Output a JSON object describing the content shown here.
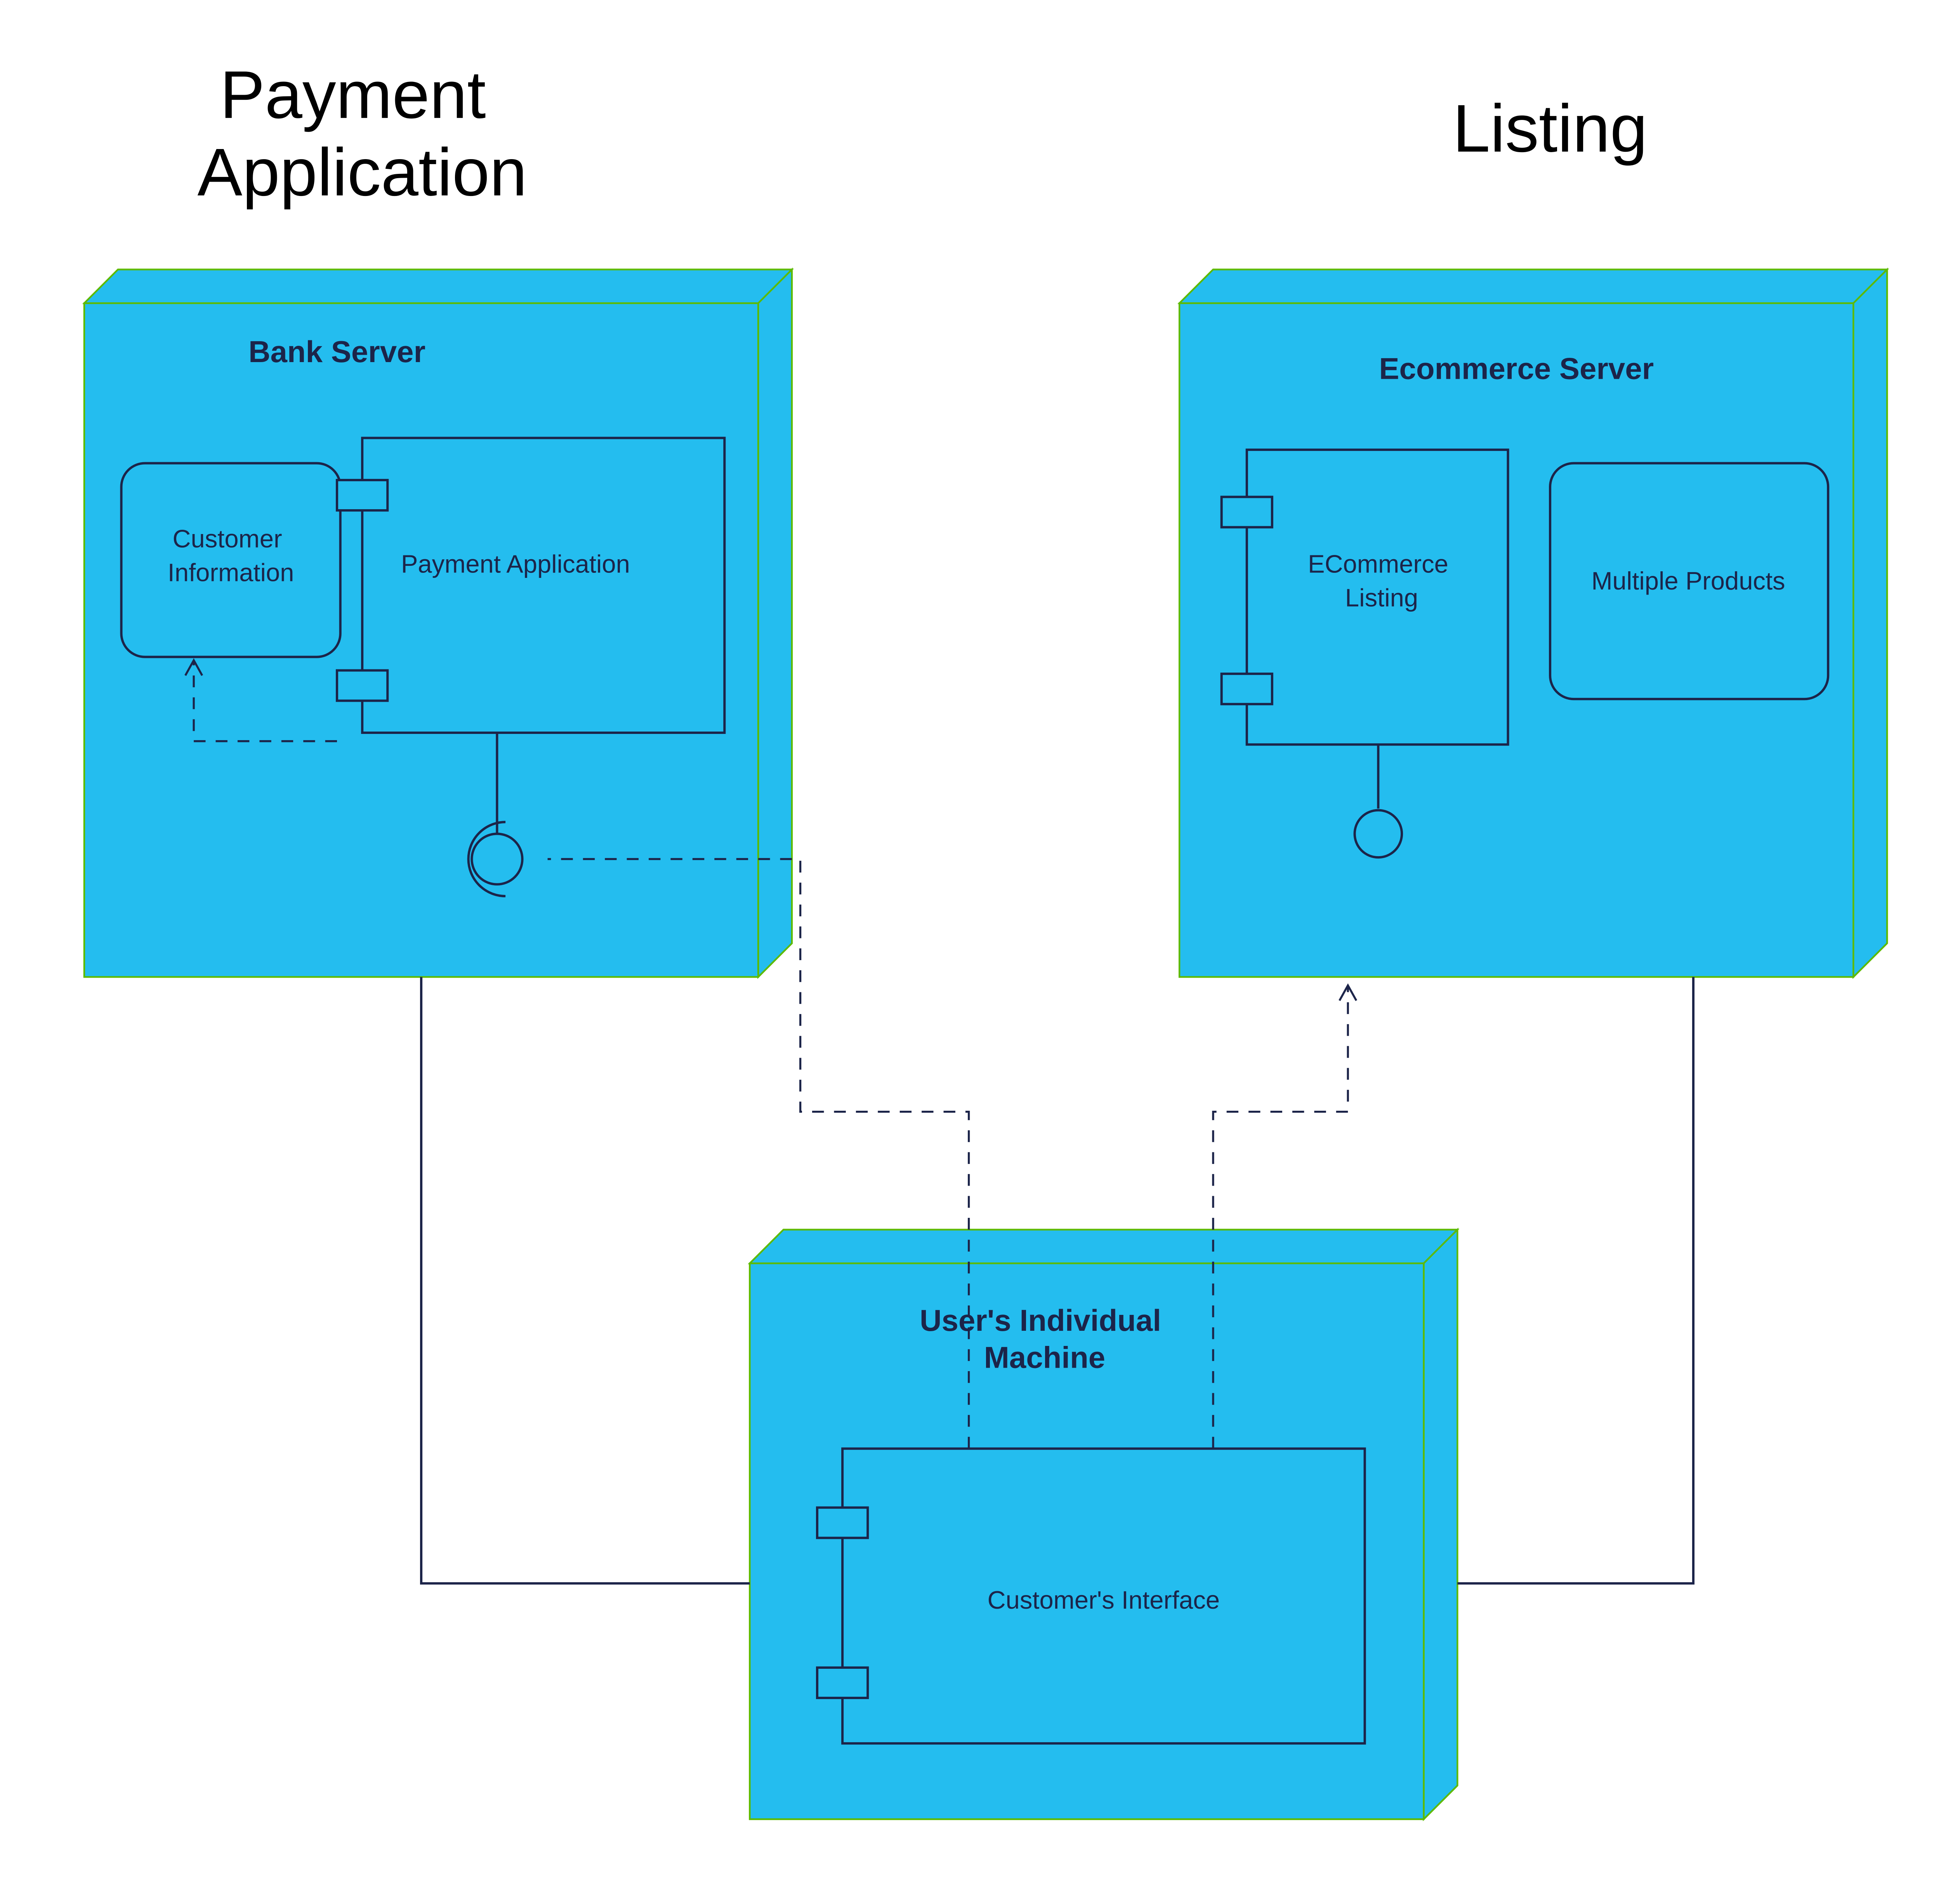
{
  "labels": {
    "title_payment": "Payment\nApplication",
    "title_listing": "Listing",
    "bank_server": "Bank Server",
    "ecommerce_server": "Ecommerce Server",
    "user_machine": "User's Individual\nMachine",
    "customer_info": "Customer\nInformation",
    "payment_app": "Payment Application",
    "ecommerce_listing": "ECommerce\nListing",
    "multiple_products": "Multiple Products",
    "customer_interface": "Customer's Interface"
  },
  "colors": {
    "node_fill": "#24bdef",
    "node_stroke": "#5dba00",
    "inner_stroke": "#1c2449",
    "title_text": "#1c2449",
    "heading_text": "#000000"
  }
}
